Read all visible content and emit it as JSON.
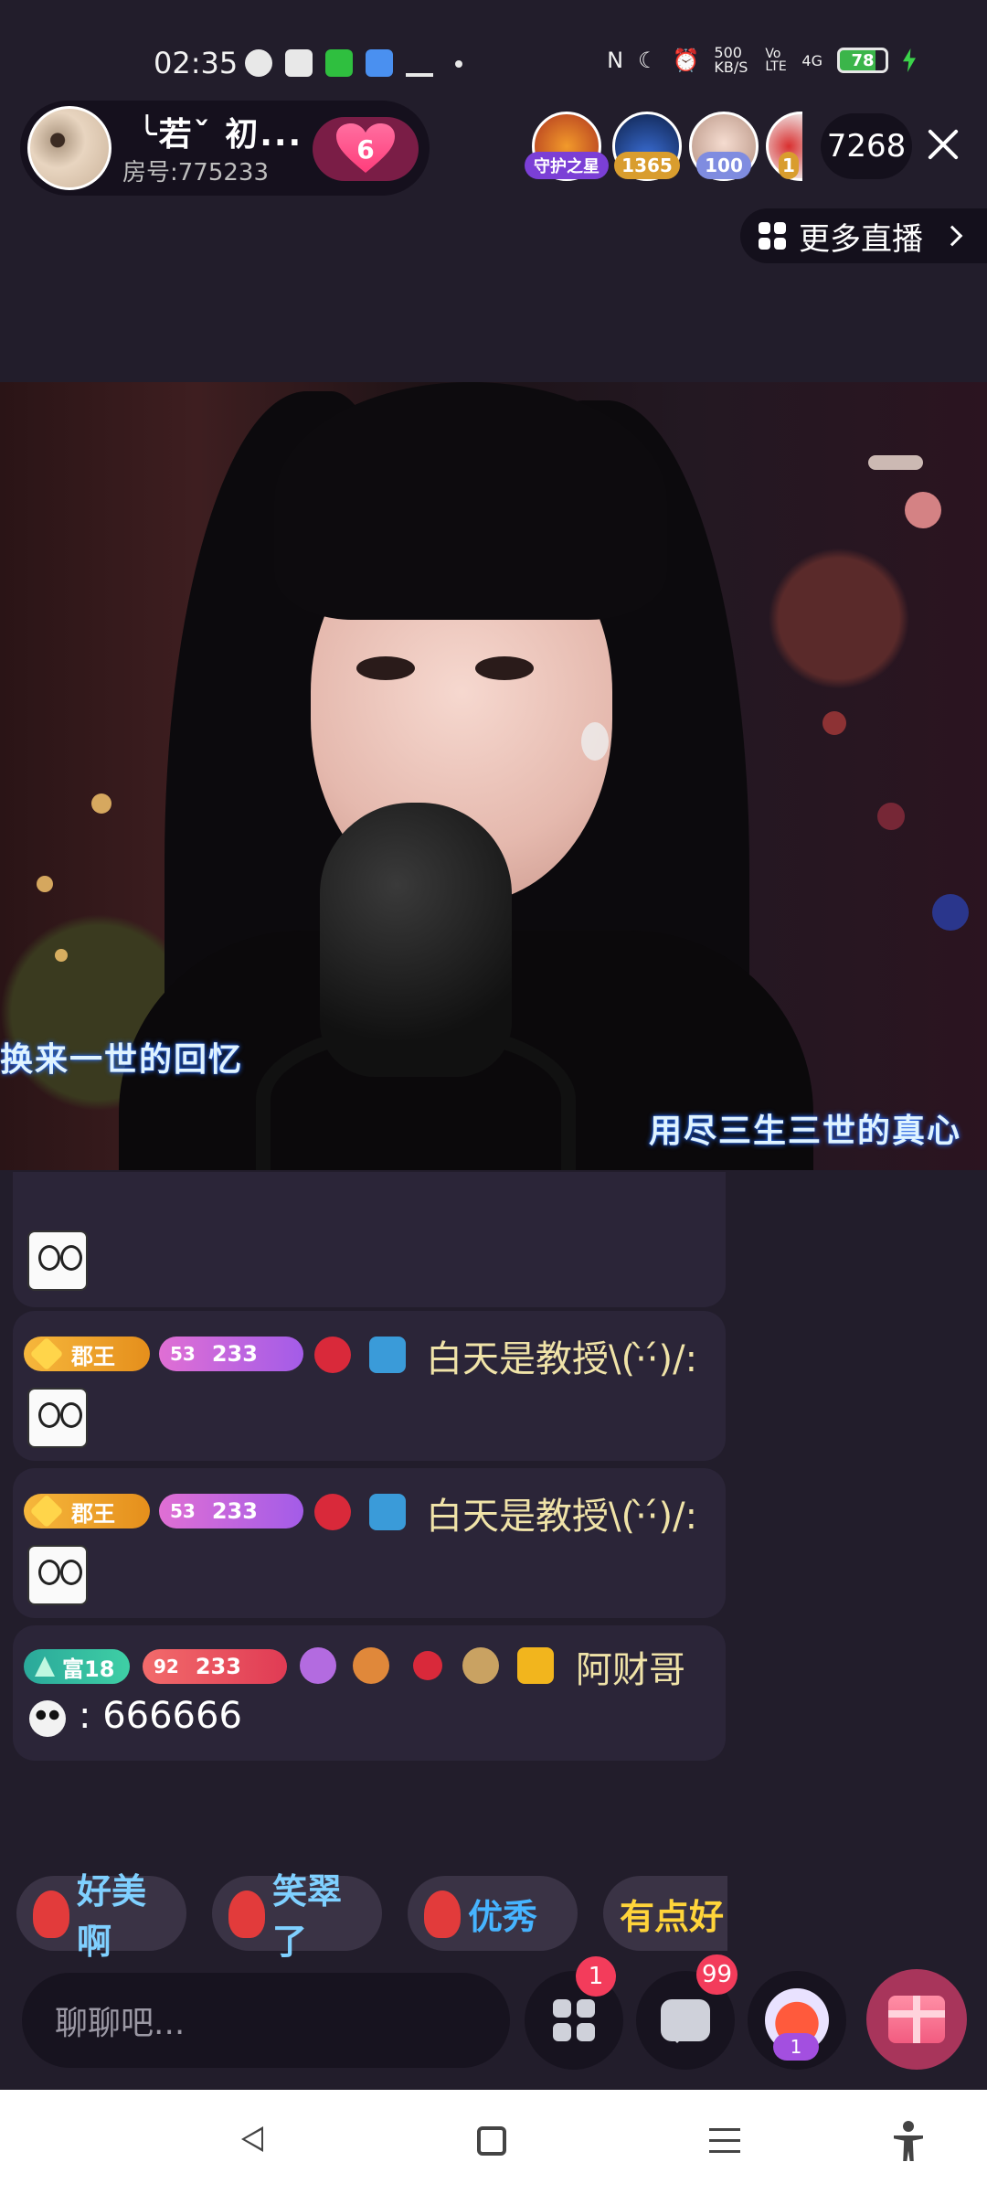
{
  "status_bar": {
    "time": "02:35",
    "network_speed": "500 KB/S",
    "volte": "Vo LTE",
    "signal": "4G",
    "battery": "78"
  },
  "host": {
    "name": "╰若ˇ 初...",
    "room_label": "房号:775233",
    "follow_count": "6"
  },
  "top_viewers": [
    {
      "tag": "守护之星"
    },
    {
      "tag": "1365"
    },
    {
      "tag": "100"
    },
    {
      "tag": "1"
    }
  ],
  "viewer_count": "7268",
  "more_live": "更多直播",
  "lyrics": {
    "left": "换来一世的回忆",
    "right": "用尽三生三世的真心"
  },
  "chat": [
    {
      "badge": "郡王",
      "level": "53",
      "level_value": "233",
      "name": "白天是教授\\(·̀·́)/:"
    },
    {
      "badge": "郡王",
      "level": "53",
      "level_value": "233",
      "name": "白天是教授\\(·̀·́)/:"
    },
    {
      "badge": "富18",
      "level": "92",
      "level_value": "233",
      "name": "阿财哥",
      "text": ": 666666"
    }
  ],
  "quick_replies": [
    "好美啊",
    "笑翠了",
    "优秀",
    "有点好"
  ],
  "input": {
    "placeholder": "聊聊吧..."
  },
  "badges": {
    "apps": "1",
    "messages": "99",
    "pk_level": "1"
  },
  "colors": {
    "accent": "#f33c5b",
    "background": "#221d2b",
    "gift": "#a8355b"
  }
}
